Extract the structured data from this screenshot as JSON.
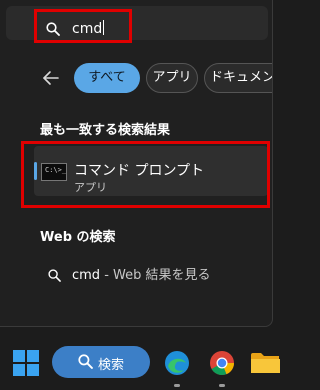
{
  "search": {
    "query": "cmd"
  },
  "tabs": {
    "all": "すべて",
    "apps": "アプリ",
    "documents": "ドキュメント"
  },
  "best_match": {
    "title": "最も一致する検索結果",
    "app_name": "コマンド プロンプト",
    "app_type": "アプリ",
    "icon_prompt": "C:\\>_"
  },
  "web": {
    "title": "Web の検索",
    "query": "cmd",
    "suffix": " - Web 結果を見る"
  },
  "taskbar": {
    "search_label": "検索"
  },
  "colors": {
    "accent": "#5aa7e6",
    "highlight": "#e00000",
    "taskbar_search": "#3c7fc7"
  }
}
